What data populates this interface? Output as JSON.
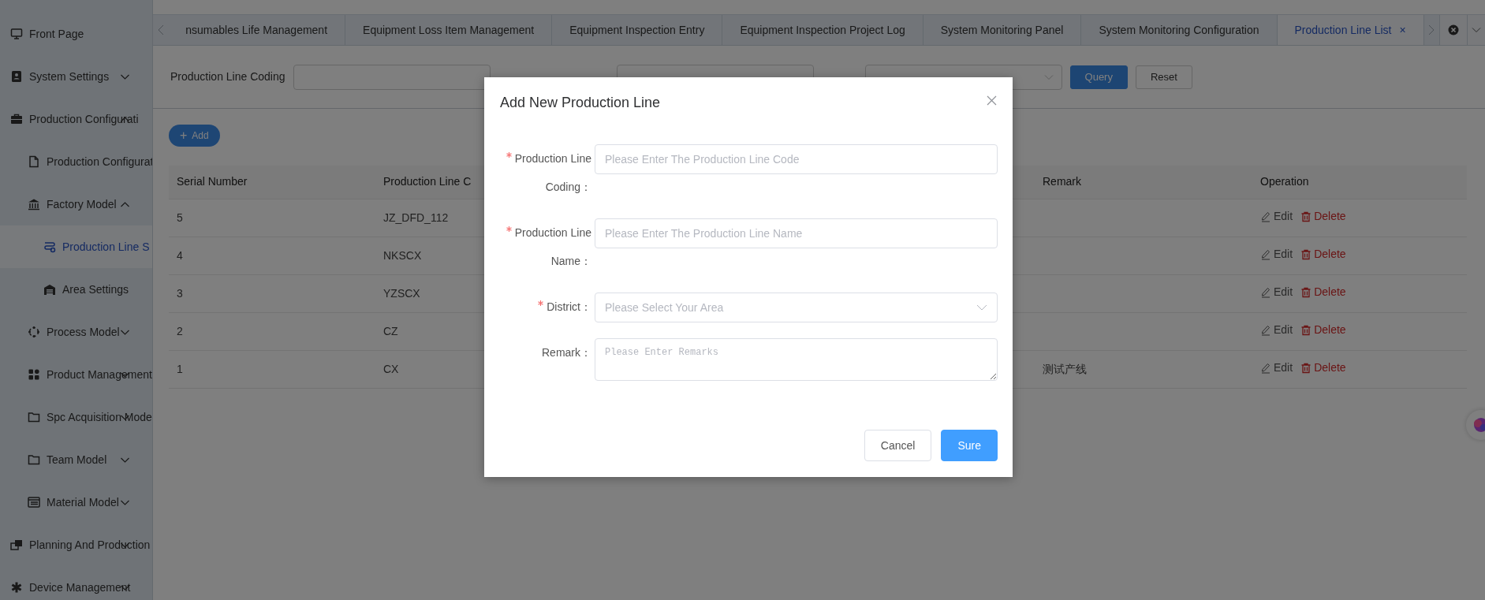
{
  "sidebar": {
    "items": [
      {
        "label": "Front Page",
        "kind": "monitor",
        "selected": false
      },
      {
        "label": "System Settings",
        "kind": "contact",
        "selected": false,
        "expanded": false
      },
      {
        "label": "Production Configurati",
        "kind": "briefcase",
        "selected": false,
        "expanded": true,
        "children": [
          {
            "label": "Production Configurat",
            "kind": "document",
            "selected": false
          },
          {
            "label": "Factory Model",
            "kind": "bank",
            "selected": false,
            "expanded": true,
            "children": [
              {
                "label": "Production Line S",
                "kind": "route",
                "selected": true
              },
              {
                "label": "Area Settings",
                "kind": "warehouse",
                "selected": false
              }
            ]
          },
          {
            "label": "Process Model",
            "kind": "cycle",
            "selected": false,
            "expanded": false
          },
          {
            "label": "Product Management",
            "kind": "grid",
            "selected": false,
            "expanded": false
          },
          {
            "label": "Spc Acquisition Mode",
            "kind": "folder",
            "selected": false,
            "expanded": false
          },
          {
            "label": "Team Model",
            "kind": "folder",
            "selected": false,
            "expanded": false
          },
          {
            "label": "Material Model",
            "kind": "table",
            "selected": false,
            "expanded": false
          }
        ]
      },
      {
        "label": "Planning And Production",
        "kind": "windows",
        "selected": false,
        "expanded": false
      },
      {
        "label": "Device Management",
        "kind": "asterisk",
        "selected": false,
        "expanded": false
      }
    ]
  },
  "tabs": [
    {
      "label": "nsumables Life Management",
      "selected": false
    },
    {
      "label": "Equipment Loss Item Management",
      "selected": false
    },
    {
      "label": "Equipment Inspection Entry",
      "selected": false
    },
    {
      "label": "Equipment Inspection Project Log",
      "selected": false
    },
    {
      "label": "System Monitoring Panel",
      "selected": false
    },
    {
      "label": "System Monitoring Configuration",
      "selected": false
    },
    {
      "label": "Production Line List",
      "selected": true,
      "close": "×"
    }
  ],
  "filters": [
    {
      "kind": "input",
      "label": "Production Line Coding"
    },
    {
      "kind": "input"
    },
    {
      "kind": "select"
    }
  ],
  "filter_buttons": [
    {
      "label": "Query",
      "kind": "primary"
    },
    {
      "label": "Reset",
      "kind": "default"
    }
  ],
  "add_button": {
    "label": "Add",
    "mark": "+"
  },
  "table": {
    "columns": [
      "Serial Number",
      "Production Line C",
      "Remark",
      "Operation"
    ],
    "rows": [
      {
        "serial": "5",
        "code": "JZ_DFD_112",
        "actions": [
          {
            "kind": "edit",
            "label": "Edit"
          },
          {
            "kind": "delete",
            "label": "Delete"
          }
        ]
      },
      {
        "serial": "4",
        "code": "NKSCX",
        "actions": [
          {
            "kind": "edit",
            "label": "Edit"
          },
          {
            "kind": "delete",
            "label": "Delete"
          }
        ]
      },
      {
        "serial": "3",
        "code": "YZSCX",
        "actions": [
          {
            "kind": "edit",
            "label": "Edit"
          },
          {
            "kind": "delete",
            "label": "Delete"
          }
        ]
      },
      {
        "serial": "2",
        "code": "CZ",
        "actions": [
          {
            "kind": "edit",
            "label": "Edit"
          },
          {
            "kind": "delete",
            "label": "Delete"
          }
        ]
      },
      {
        "serial": "1",
        "code": "CX",
        "remark": "测试产线",
        "actions": [
          {
            "kind": "edit",
            "label": "Edit"
          },
          {
            "kind": "delete",
            "label": "Delete"
          }
        ]
      }
    ]
  },
  "dialog": {
    "title": "Add New Production Line",
    "fields": [
      {
        "kind": "input",
        "label": "Production Line Coding：",
        "required": true,
        "placeholder": "Please Enter The Production Line Code"
      },
      {
        "kind": "input",
        "label": "Production Line Name：",
        "required": true,
        "placeholder": "Please Enter The Production Line Name"
      },
      {
        "kind": "select",
        "label": "District：",
        "required": true,
        "placeholder": "Please Select Your Area"
      },
      {
        "kind": "textarea",
        "label": "Remark：",
        "required": false,
        "placeholder": "Please Enter Remarks"
      }
    ],
    "buttons": [
      {
        "label": "Cancel",
        "kind": "default"
      },
      {
        "label": "Sure",
        "kind": "primary"
      }
    ]
  }
}
